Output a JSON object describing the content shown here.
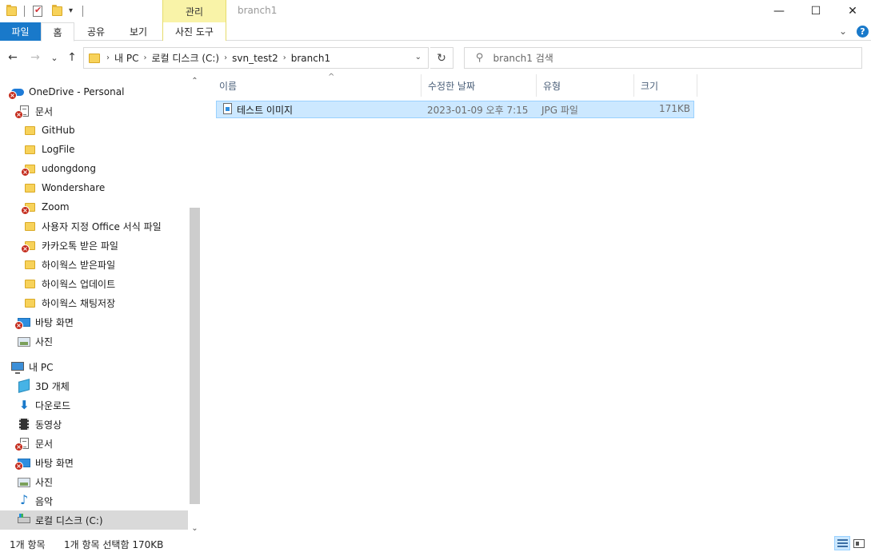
{
  "window": {
    "title": "branch1",
    "context_tab": "관리",
    "controls": {
      "minimize": "—",
      "maximize": "☐",
      "close": "✕"
    }
  },
  "ribbon": {
    "tabs": [
      {
        "label": "파일"
      },
      {
        "label": "홈"
      },
      {
        "label": "공유"
      },
      {
        "label": "보기"
      },
      {
        "label": "사진 도구"
      }
    ],
    "help": "?"
  },
  "nav": {
    "back": "←",
    "forward": "→",
    "recent": "⌄",
    "up": "↑",
    "breadcrumbs": [
      "내 PC",
      "로컬 디스크 (C:)",
      "svn_test2",
      "branch1"
    ],
    "refresh": "↻",
    "search_placeholder": "branch1 검색"
  },
  "tree": [
    {
      "label": "OneDrive - Personal",
      "icon": "onedrive-cloud-icon",
      "error": true
    },
    {
      "label": "문서",
      "icon": "document-icon",
      "error": true
    },
    {
      "label": "GitHub",
      "icon": "folder-icon",
      "error": false
    },
    {
      "label": "LogFile",
      "icon": "folder-icon",
      "error": false
    },
    {
      "label": "udongdong",
      "icon": "folder-icon",
      "error": true
    },
    {
      "label": "Wondershare",
      "icon": "folder-icon",
      "error": false
    },
    {
      "label": "Zoom",
      "icon": "folder-icon",
      "error": true
    },
    {
      "label": "사용자 지정 Office 서식 파일",
      "icon": "folder-icon",
      "error": false
    },
    {
      "label": "카카오톡 받은 파일",
      "icon": "folder-icon",
      "error": true
    },
    {
      "label": "하이웍스 받은파일",
      "icon": "folder-icon",
      "error": false
    },
    {
      "label": "하이웍스 업데이트",
      "icon": "folder-icon",
      "error": false
    },
    {
      "label": "하이웍스 채팅저장",
      "icon": "folder-icon",
      "error": false
    },
    {
      "label": "바탕 화면",
      "icon": "desktop-icon",
      "error": true
    },
    {
      "label": "사진",
      "icon": "pictures-icon",
      "error": false
    },
    {
      "label": "내 PC",
      "icon": "this-pc-icon",
      "error": false
    },
    {
      "label": "3D 개체",
      "icon": "3d-objects-icon",
      "error": false
    },
    {
      "label": "다운로드",
      "icon": "downloads-icon",
      "error": false
    },
    {
      "label": "동영상",
      "icon": "videos-icon",
      "error": false
    },
    {
      "label": "문서",
      "icon": "document-icon",
      "error": true
    },
    {
      "label": "바탕 화면",
      "icon": "desktop-icon",
      "error": true
    },
    {
      "label": "사진",
      "icon": "pictures-icon",
      "error": false
    },
    {
      "label": "음악",
      "icon": "music-icon",
      "error": false
    },
    {
      "label": "로컬 디스크 (C:)",
      "icon": "local-disk-icon",
      "error": false,
      "selected": true
    }
  ],
  "columns": [
    "이름",
    "수정한 날짜",
    "유형",
    "크기"
  ],
  "files": [
    {
      "name": "테스트 이미지",
      "modified": "2023-01-09 오후 7:15",
      "type": "JPG 파일",
      "size": "171KB",
      "selected": true
    }
  ],
  "status": {
    "count": "1개 항목",
    "selection": "1개 항목 선택함 170KB"
  },
  "colors": {
    "file_tab": "#1979ca",
    "context_tab": "#f9f3a8",
    "selection": "#cce8ff",
    "error_badge": "#c42b1c"
  }
}
